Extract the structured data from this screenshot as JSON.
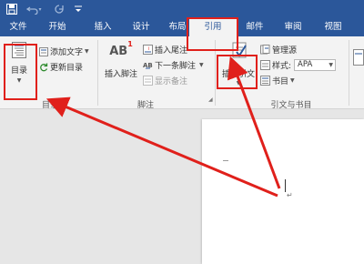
{
  "quick_access": {
    "icons": [
      "save-icon",
      "undo-icon",
      "redo-icon",
      "customize-icon"
    ]
  },
  "tabs": [
    {
      "label": "文件"
    },
    {
      "label": "开始"
    },
    {
      "label": "插入"
    },
    {
      "label": "设计"
    },
    {
      "label": "布局"
    },
    {
      "label": "引用",
      "active": true
    },
    {
      "label": "邮件"
    },
    {
      "label": "审阅"
    },
    {
      "label": "视图"
    }
  ],
  "ribbon": {
    "toc_group": {
      "toc_button": "目录",
      "add_text": "添加文字",
      "update_toc": "更新目录",
      "label": "目录"
    },
    "footnote_group": {
      "insert_footnote": "插入脚注",
      "insert_endnote": "插入尾注",
      "next_footnote": "下一条脚注",
      "show_notes": "显示备注",
      "label": "脚注",
      "ab_icon_text": "AB",
      "ab_superscript": "1"
    },
    "citation_group": {
      "insert_citation": "插入引文",
      "manage_sources": "管理源",
      "style_label": "样式:",
      "style_value": "APA",
      "bibliography": "书目",
      "label": "引文与书目"
    }
  },
  "colors": {
    "accent": "#2b579a",
    "highlight": "#e0201b"
  }
}
